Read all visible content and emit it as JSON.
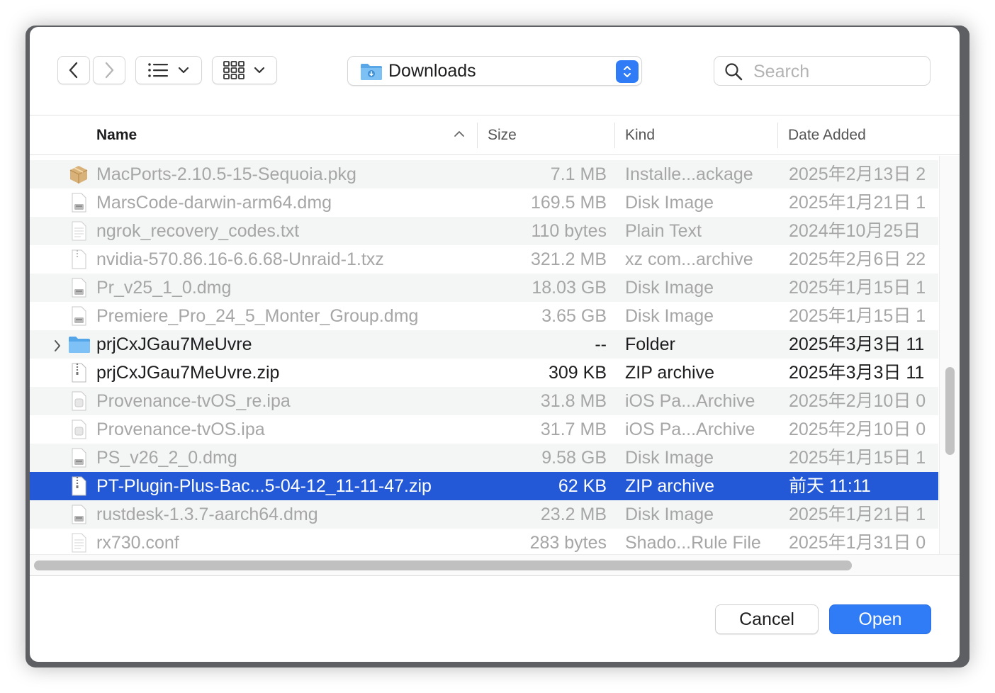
{
  "toolbar": {
    "location": "Downloads",
    "search_placeholder": "Search"
  },
  "columns": {
    "name": "Name",
    "size": "Size",
    "kind": "Kind",
    "date": "Date Added"
  },
  "rows": [
    {
      "name": "MacPorts-2.10.5-15-Sequoia.pkg",
      "size": "7.1 MB",
      "kind": "Installe...ackage",
      "date": "2025年2月13日 2",
      "icon": "package-icon",
      "state": "dim"
    },
    {
      "name": "MarsCode-darwin-arm64.dmg",
      "size": "169.5 MB",
      "kind": "Disk Image",
      "date": "2025年1月21日 1",
      "icon": "disk-image-icon",
      "state": "dim"
    },
    {
      "name": "ngrok_recovery_codes.txt",
      "size": "110 bytes",
      "kind": "Plain Text",
      "date": "2024年10月25日",
      "icon": "text-file-icon",
      "state": "dim"
    },
    {
      "name": "nvidia-570.86.16-6.6.68-Unraid-1.txz",
      "size": "321.2 MB",
      "kind": "xz com...archive",
      "date": "2025年2月6日 22",
      "icon": "archive-icon",
      "state": "dim"
    },
    {
      "name": "Pr_v25_1_0.dmg",
      "size": "18.03 GB",
      "kind": "Disk Image",
      "date": "2025年1月15日 1",
      "icon": "disk-image-icon",
      "state": "dim"
    },
    {
      "name": "Premiere_Pro_24_5_Monter_Group.dmg",
      "size": "3.65 GB",
      "kind": "Disk Image",
      "date": "2025年1月15日 1",
      "icon": "disk-image-icon",
      "state": "dim"
    },
    {
      "name": "prjCxJGau7MeUvre",
      "size": "--",
      "kind": "Folder",
      "date": "2025年3月3日 11",
      "icon": "folder-icon",
      "state": "norm",
      "folder": true
    },
    {
      "name": "prjCxJGau7MeUvre.zip",
      "size": "309 KB",
      "kind": "ZIP archive",
      "date": "2025年3月3日 11",
      "icon": "zip-icon",
      "state": "norm"
    },
    {
      "name": "Provenance-tvOS_re.ipa",
      "size": "31.8 MB",
      "kind": "iOS Pa...Archive",
      "date": "2025年2月10日 0",
      "icon": "ipa-icon",
      "state": "dim"
    },
    {
      "name": "Provenance-tvOS.ipa",
      "size": "31.7 MB",
      "kind": "iOS Pa...Archive",
      "date": "2025年2月10日 0",
      "icon": "ipa-icon",
      "state": "dim"
    },
    {
      "name": "PS_v26_2_0.dmg",
      "size": "9.58 GB",
      "kind": "Disk Image",
      "date": "2025年1月15日 1",
      "icon": "disk-image-icon",
      "state": "dim"
    },
    {
      "name": "PT-Plugin-Plus-Bac...5-04-12_11-11-47.zip",
      "size": "62 KB",
      "kind": "ZIP archive",
      "date": "前天 11:11",
      "icon": "zip-icon",
      "state": "sel"
    },
    {
      "name": "rustdesk-1.3.7-aarch64.dmg",
      "size": "23.2 MB",
      "kind": "Disk Image",
      "date": "2025年1月21日 1",
      "icon": "disk-image-icon",
      "state": "dim"
    },
    {
      "name": "rx730.conf",
      "size": "283 bytes",
      "kind": "Shado...Rule File",
      "date": "2025年1月31日 0",
      "icon": "text-file-icon",
      "state": "dim"
    }
  ],
  "buttons": {
    "cancel": "Cancel",
    "open": "Open"
  }
}
